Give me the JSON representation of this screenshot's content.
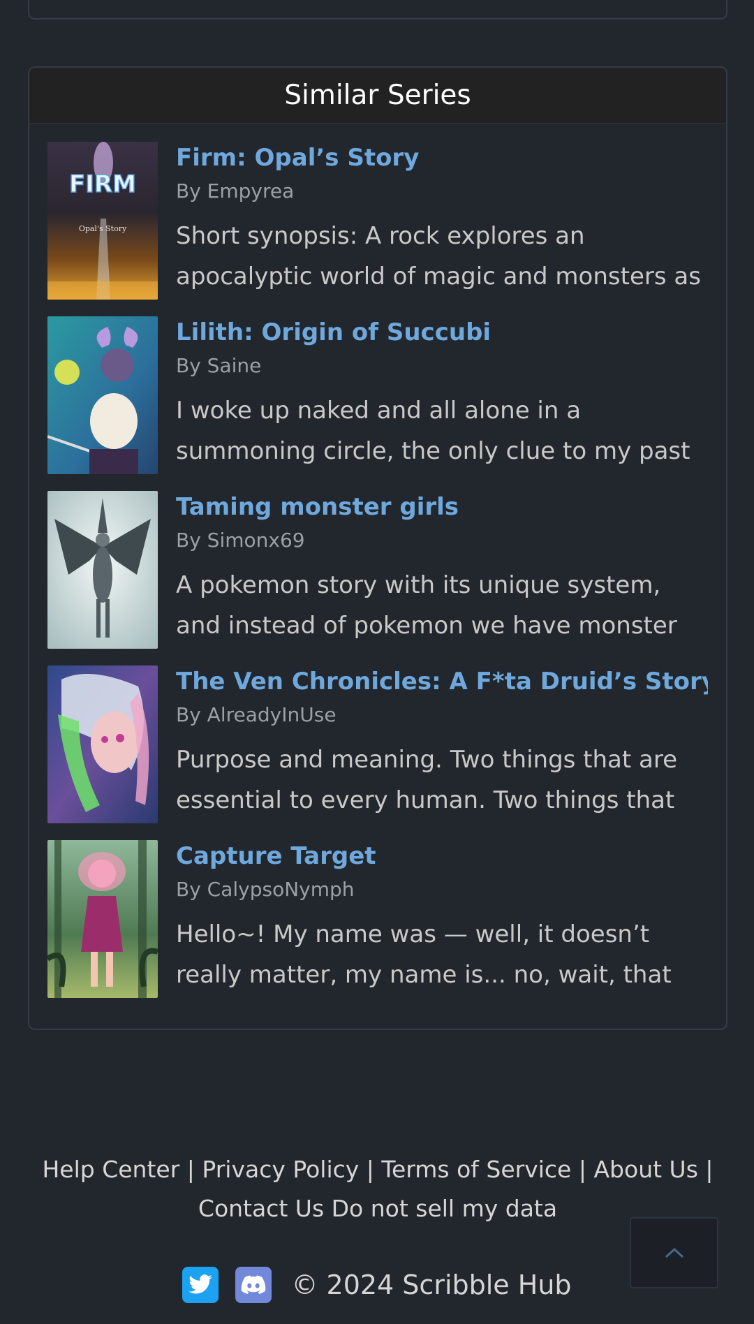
{
  "section_title": "Similar Series",
  "series": [
    {
      "title": "Firm: Opal’s Story",
      "author": "By Empyrea",
      "synopsis": "Short synopsis: A rock explores an apocalyptic world of magic and monsters as she kills",
      "cover_text": "FIRM",
      "cover_subtext": "Opal's Story"
    },
    {
      "title": "Lilith: Origin of Succubi",
      "author": "By Saine",
      "synopsis": "I woke up naked and all alone in a summoning circle, the only clue to my past is"
    },
    {
      "title": "Taming monster girls",
      "author": "By Simonx69",
      "synopsis": "A pokemon story with its unique system, and instead of pokemon we have monster girls"
    },
    {
      "title": "The Ven Chronicles: A F*ta Druid’s Story!",
      "author": "By AlreadyInUse",
      "synopsis": "Purpose and meaning. Two things that are essential to every human. Two things that"
    },
    {
      "title": "Capture Target",
      "author": "By CalypsoNymph",
      "synopsis": "Hello~! My name was — well, it doesn’t really matter, my name is... no, wait, that doesn’t"
    }
  ],
  "footer": {
    "help_center": "Help Center",
    "privacy_policy": "Privacy Policy",
    "terms": "Terms of Service",
    "about": "About Us",
    "contact": "Contact Us",
    "do_not_sell": "Do not sell my data",
    "separator": "|",
    "copyright": "© 2024 Scribble Hub"
  },
  "icons": {
    "back_to_top": "chevron-up-icon",
    "twitter": "twitter-icon",
    "discord": "discord-icon"
  },
  "colors": {
    "background": "#22272e",
    "link_title": "#6fa8dc",
    "header_bg": "#222222",
    "twitter": "#1da1f2",
    "discord": "#7289da"
  }
}
